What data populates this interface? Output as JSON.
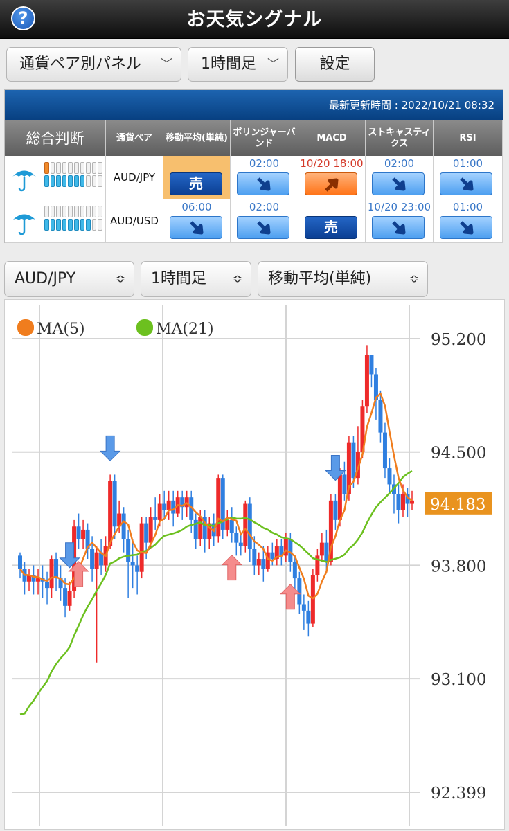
{
  "header": {
    "title": "お天気シグナル",
    "help_glyph": "?"
  },
  "controls": {
    "panel_select": "通貨ペア別パネル",
    "timeframe_select": "1時間足",
    "settings_label": "設定"
  },
  "panel": {
    "updated_label": "最新更新時間 : 2022/10/21 08:32",
    "headers": [
      "総合判断",
      "通貨ペア",
      "移動平均(単純)",
      "ボリンジャーバンド",
      "MACD",
      "ストキャスティクス",
      "RSI"
    ],
    "rows": [
      {
        "pair": "AUD/JPY",
        "weather": "umbrella-icon",
        "gauge_top": 1,
        "gauge_bottom": 7,
        "signals": [
          {
            "time": "",
            "type": "sell",
            "label": "売",
            "highlight": true
          },
          {
            "time": "02:00",
            "type": "down",
            "label": ""
          },
          {
            "time": "10/20 18:00",
            "type": "up",
            "label": "",
            "red": true
          },
          {
            "time": "02:00",
            "type": "down",
            "label": ""
          },
          {
            "time": "01:00",
            "type": "down",
            "label": ""
          }
        ]
      },
      {
        "pair": "AUD/USD",
        "weather": "umbrella-icon",
        "gauge_top": 0,
        "gauge_bottom": 8,
        "signals": [
          {
            "time": "06:00",
            "type": "down",
            "label": ""
          },
          {
            "time": "02:00",
            "type": "down",
            "label": ""
          },
          {
            "time": "",
            "type": "sell",
            "label": "売"
          },
          {
            "time": "10/20 23:00",
            "type": "down",
            "label": ""
          },
          {
            "time": "01:00",
            "type": "down",
            "label": ""
          }
        ]
      }
    ]
  },
  "chart_controls": {
    "pair_select": "AUD/JPY",
    "timeframe_select": "1時間足",
    "indicator_select": "移動平均(単純)"
  },
  "chart_data": {
    "type": "candlestick",
    "title": "",
    "legend": [
      {
        "name": "MA(5)",
        "color": "#f07d1e"
      },
      {
        "name": "MA(21)",
        "color": "#6cc01f"
      }
    ],
    "legend_placement": "top-left",
    "ylim": [
      92.399,
      95.2
    ],
    "yticks": [
      "95.200",
      "94.500",
      "93.800",
      "93.100",
      "92.399"
    ],
    "current_price": "94.183",
    "colors": {
      "up": "#ee2a2a",
      "down": "#2f7fe0",
      "current": "#e9931f"
    },
    "grid": true,
    "candles": [
      [
        93.86,
        93.78,
        93.88,
        93.72
      ],
      [
        93.78,
        93.7,
        93.82,
        93.62
      ],
      [
        93.7,
        93.74,
        93.78,
        93.64
      ],
      [
        93.74,
        93.7,
        93.8,
        93.62
      ],
      [
        93.7,
        93.72,
        93.78,
        93.62
      ],
      [
        93.72,
        93.7,
        93.8,
        93.6
      ],
      [
        93.7,
        93.66,
        93.76,
        93.56
      ],
      [
        93.66,
        93.84,
        93.86,
        93.6
      ],
      [
        93.84,
        93.72,
        93.88,
        93.64
      ],
      [
        93.72,
        93.66,
        93.8,
        93.58
      ],
      [
        93.66,
        93.55,
        93.72,
        93.48
      ],
      [
        93.55,
        93.64,
        93.7,
        93.52
      ],
      [
        93.64,
        94.04,
        94.08,
        93.6
      ],
      [
        94.04,
        93.96,
        94.12,
        93.9
      ],
      [
        93.96,
        94.02,
        94.08,
        93.9
      ],
      [
        94.02,
        93.9,
        94.06,
        93.84
      ],
      [
        93.9,
        93.78,
        93.98,
        93.7
      ],
      [
        93.78,
        93.88,
        93.92,
        93.2
      ],
      [
        93.88,
        93.8,
        93.96,
        93.74
      ],
      [
        93.8,
        93.92,
        93.98,
        93.76
      ],
      [
        93.92,
        94.32,
        94.36,
        93.9
      ],
      [
        94.32,
        94.04,
        94.36,
        93.96
      ],
      [
        94.04,
        94.12,
        94.2,
        94.0
      ],
      [
        94.12,
        93.96,
        94.16,
        93.88
      ],
      [
        93.96,
        93.82,
        94.02,
        93.6
      ],
      [
        93.82,
        93.8,
        93.96,
        93.66
      ],
      [
        93.8,
        93.76,
        93.86,
        93.62
      ],
      [
        93.76,
        94.06,
        94.1,
        93.72
      ],
      [
        94.06,
        93.94,
        94.1,
        93.84
      ],
      [
        93.94,
        94.1,
        94.16,
        93.9
      ],
      [
        94.1,
        94.08,
        94.22,
        94.02
      ],
      [
        94.08,
        94.18,
        94.24,
        94.04
      ],
      [
        94.18,
        94.14,
        94.26,
        94.08
      ],
      [
        94.14,
        94.2,
        94.26,
        94.08
      ],
      [
        94.2,
        94.12,
        94.26,
        94.04
      ],
      [
        94.12,
        94.22,
        94.26,
        94.1
      ],
      [
        94.22,
        94.16,
        94.26,
        94.08
      ],
      [
        94.16,
        94.22,
        94.26,
        94.1
      ],
      [
        94.22,
        94.08,
        94.26,
        94.0
      ],
      [
        94.08,
        93.96,
        94.12,
        93.9
      ],
      [
        93.96,
        94.1,
        94.14,
        93.92
      ],
      [
        94.1,
        93.96,
        94.14,
        93.88
      ],
      [
        93.96,
        94.06,
        94.1,
        93.9
      ],
      [
        94.06,
        93.98,
        94.12,
        93.92
      ],
      [
        93.98,
        94.34,
        94.36,
        93.94
      ],
      [
        94.34,
        94.02,
        94.36,
        93.96
      ],
      [
        94.02,
        94.08,
        94.14,
        93.98
      ],
      [
        94.08,
        94.0,
        94.16,
        93.94
      ],
      [
        94.0,
        93.94,
        94.04,
        93.86
      ],
      [
        93.94,
        93.92,
        94.0,
        93.86
      ],
      [
        93.92,
        94.18,
        94.2,
        93.88
      ],
      [
        94.18,
        93.9,
        94.22,
        93.82
      ],
      [
        93.9,
        93.8,
        93.98,
        93.74
      ],
      [
        93.8,
        93.84,
        93.88,
        93.74
      ],
      [
        93.84,
        93.78,
        93.92,
        93.7
      ],
      [
        93.78,
        93.88,
        93.92,
        93.76
      ],
      [
        93.88,
        93.84,
        93.94,
        93.8
      ],
      [
        93.84,
        93.92,
        93.96,
        93.8
      ],
      [
        93.92,
        93.86,
        93.96,
        93.8
      ],
      [
        93.86,
        93.96,
        94.0,
        93.82
      ],
      [
        93.96,
        93.82,
        94.0,
        93.76
      ],
      [
        93.82,
        93.72,
        93.86,
        93.62
      ],
      [
        93.72,
        93.56,
        93.76,
        93.5
      ],
      [
        93.56,
        93.52,
        93.62,
        93.4
      ],
      [
        93.52,
        93.44,
        93.58,
        93.36
      ],
      [
        93.44,
        93.74,
        93.78,
        93.42
      ],
      [
        93.74,
        93.86,
        93.9,
        93.7
      ],
      [
        93.86,
        93.94,
        94.0,
        93.82
      ],
      [
        93.94,
        93.82,
        94.02,
        93.76
      ],
      [
        93.82,
        94.2,
        94.24,
        93.8
      ],
      [
        94.2,
        94.08,
        94.24,
        94.02
      ],
      [
        94.08,
        94.36,
        94.4,
        94.04
      ],
      [
        94.36,
        94.24,
        94.44,
        94.2
      ],
      [
        94.24,
        94.56,
        94.6,
        94.2
      ],
      [
        94.56,
        94.34,
        94.6,
        94.28
      ],
      [
        94.34,
        94.5,
        94.66,
        94.3
      ],
      [
        94.5,
        94.78,
        94.82,
        94.46
      ],
      [
        94.78,
        95.1,
        95.16,
        94.74
      ],
      [
        95.1,
        94.98,
        95.08,
        94.9
      ],
      [
        94.98,
        94.82,
        95.02,
        94.7
      ],
      [
        94.82,
        94.62,
        94.88,
        94.56
      ],
      [
        94.62,
        94.4,
        94.68,
        94.34
      ],
      [
        94.4,
        94.3,
        94.46,
        94.24
      ],
      [
        94.3,
        94.24,
        94.36,
        94.12
      ],
      [
        94.24,
        94.14,
        94.3,
        94.06
      ],
      [
        94.14,
        94.24,
        94.3,
        94.1
      ],
      [
        94.24,
        94.18,
        94.28,
        94.1
      ],
      [
        94.18,
        94.2,
        94.26,
        94.14
      ]
    ],
    "signals": [
      {
        "index": 11,
        "type": "sell"
      },
      {
        "index": 13,
        "type": "buy"
      },
      {
        "index": 20,
        "type": "sell"
      },
      {
        "index": 47,
        "type": "buy"
      },
      {
        "index": 60,
        "type": "buy"
      },
      {
        "index": 70,
        "type": "sell"
      }
    ]
  }
}
